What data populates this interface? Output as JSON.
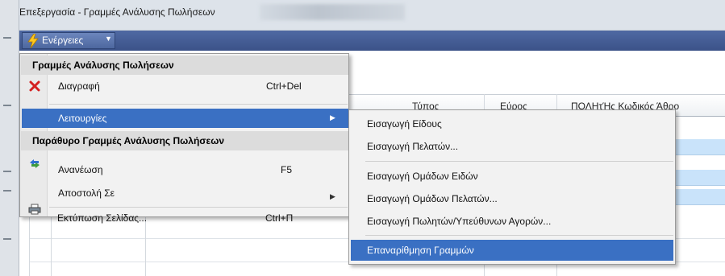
{
  "window": {
    "title": "Επεξεργασία - Γραμμές Ανάλυσης Πωλήσεων"
  },
  "toolbar": {
    "actions_label": "Ενέργειες",
    "actions_icon": "lightning-bolt-icon"
  },
  "grid": {
    "columns": [
      "Τύπος",
      "Εύρος",
      "ΠΟΛΗτΉς Κωδικός Άθρο"
    ],
    "highlight_color": "#c9e3fa"
  },
  "menu": {
    "section1_header": "Γραμμές Ανάλυσης Πωλήσεων",
    "items": {
      "delete": {
        "label": "Διαγραφή",
        "shortcut": "Ctrl+Del",
        "icon": "delete-x-icon"
      },
      "functions": {
        "label": "Λειτουργίες"
      }
    },
    "section2_header": "Παράθυρο Γραμμές Ανάλυσης Πωλήσεων",
    "items2": {
      "refresh": {
        "label": "Ανανέωση",
        "shortcut": "F5",
        "icon": "refresh-icon"
      },
      "send_to": {
        "label": "Αποστολή Σε"
      },
      "print_page": {
        "label": "Εκτύπωση Σελίδας...",
        "shortcut": "Ctrl+Π",
        "icon": "printer-icon"
      }
    }
  },
  "submenu": {
    "items": [
      "Εισαγωγή Είδους",
      "Εισαγωγή Πελατών...",
      "Εισαγωγή Ομάδων Ειδών",
      "Εισαγωγή Ομάδων Πελατών...",
      "Εισαγωγή Πωλητών/Υπεύθυνων Αγορών...",
      "Επαναρίθμηση Γραμμών"
    ]
  },
  "colors": {
    "accent": "#3a70c3",
    "toolbar": "#4a62a0"
  }
}
